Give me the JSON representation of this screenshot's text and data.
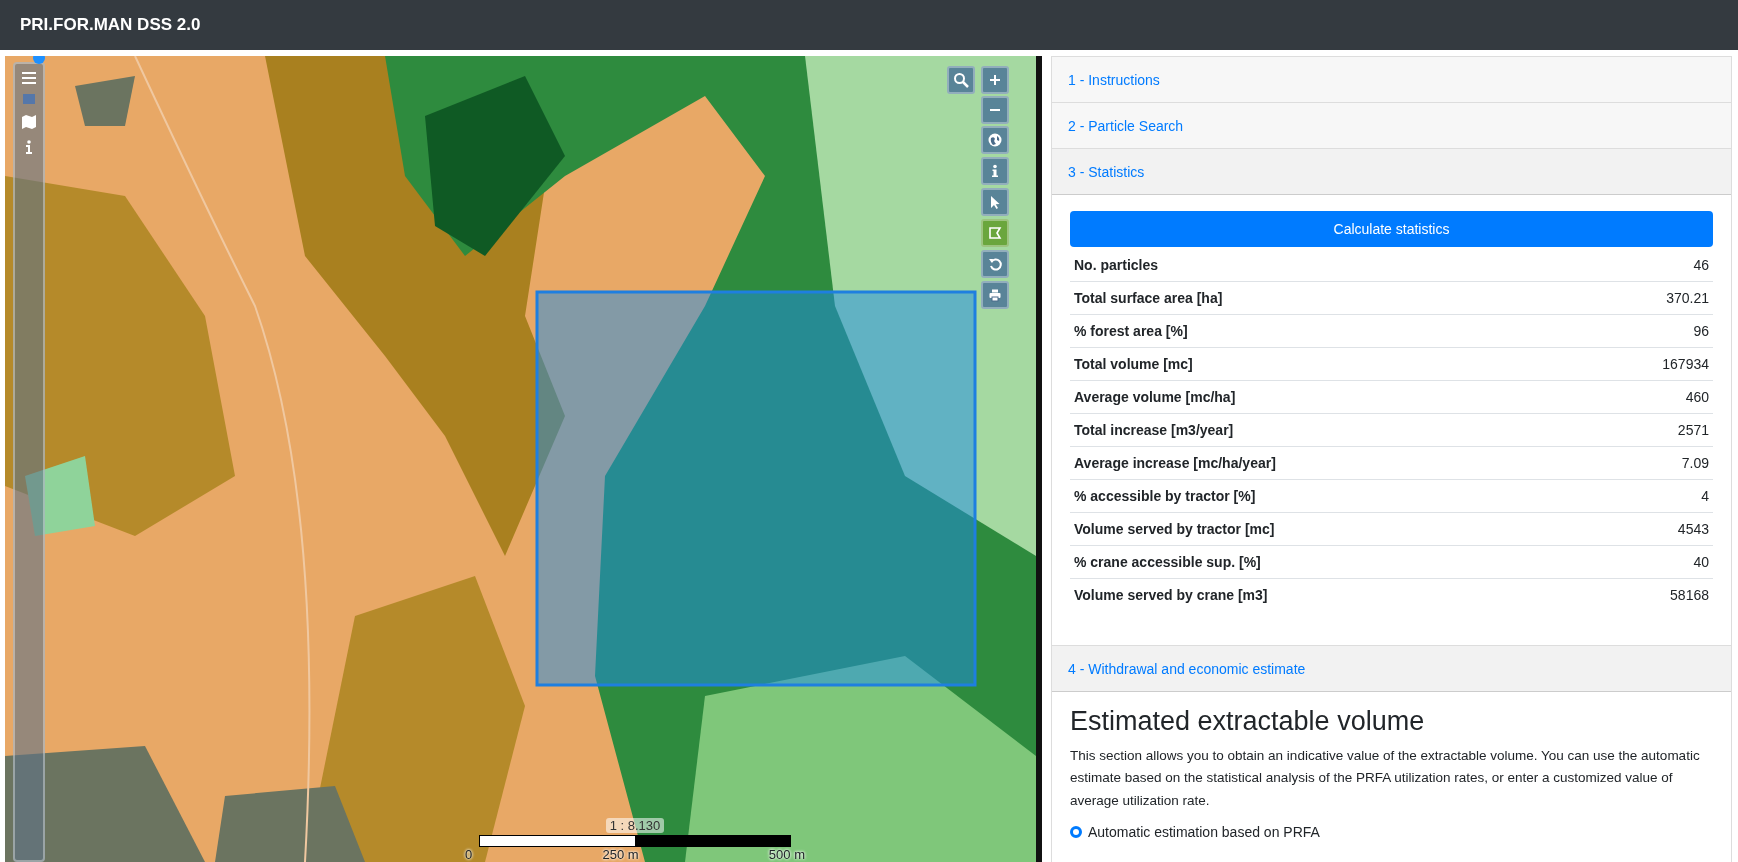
{
  "header": {
    "title": "PRI.FOR.MAN DSS 2.0"
  },
  "map": {
    "tools": [
      {
        "selected": false
      },
      {
        "selected": false
      },
      {
        "selected": false
      },
      {
        "selected": true
      },
      {
        "selected": false
      },
      {
        "selected": false
      }
    ],
    "scale": {
      "ratio": "1 : 8.130",
      "ticks": [
        "0",
        "250 m",
        "500 m"
      ]
    }
  },
  "sections": [
    {
      "title": "1 - Instructions",
      "expanded": false
    },
    {
      "title": "2 - Particle Search",
      "expanded": false
    },
    {
      "title": "3 - Statistics",
      "expanded": true,
      "kind": "stats",
      "button": "Calculate statistics",
      "rows": [
        {
          "label": "No. particles",
          "value": "46"
        },
        {
          "label": "Total surface area [ha]",
          "value": "370.21"
        },
        {
          "label": "% forest area [%]",
          "value": "96"
        },
        {
          "label": "Total volume [mc]",
          "value": "167934"
        },
        {
          "label": "Average volume [mc/ha]",
          "value": "460"
        },
        {
          "label": "Total increase [m3/year]",
          "value": "2571"
        },
        {
          "label": "Average increase [mc/ha/year]",
          "value": "7.09"
        },
        {
          "label": "% accessible by tractor [%]",
          "value": "4"
        },
        {
          "label": "Volume served by tractor [mc]",
          "value": "4543"
        },
        {
          "label": "% crane accessible sup. [%]",
          "value": "40"
        },
        {
          "label": "Volume served by crane [m3]",
          "value": "58168"
        }
      ]
    },
    {
      "title": "4 - Withdrawal and economic estimate",
      "expanded": true,
      "kind": "estimate",
      "heading": "Estimated extractable volume",
      "text": "This section allows you to obtain an indicative value of the extractable volume. You can use the automatic estimate based on the statistical analysis of the PRFA utilization rates, or enter a customized value of average utilization rate.",
      "options": [
        {
          "label": "Automatic estimation based on PRFA",
          "selected": true
        }
      ]
    }
  ]
}
